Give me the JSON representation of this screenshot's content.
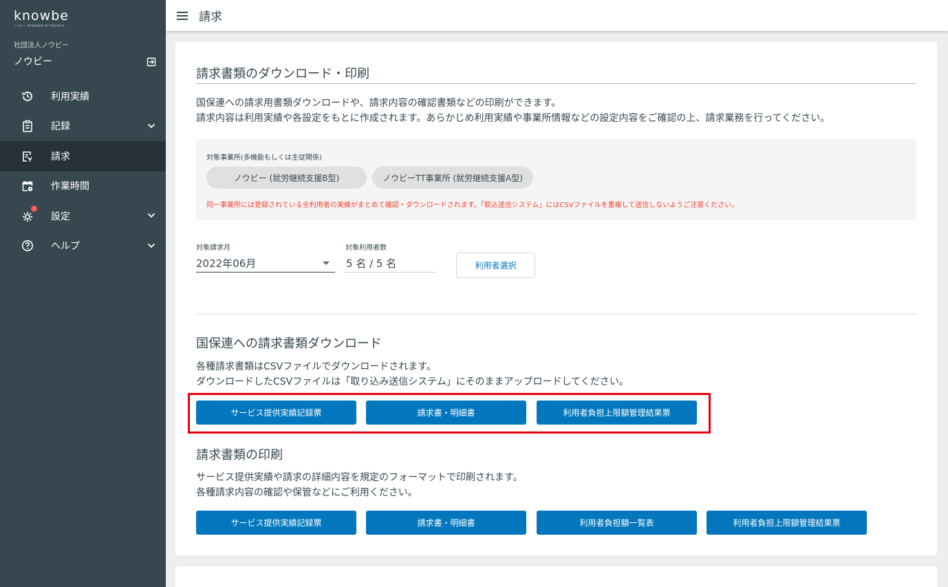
{
  "app": {
    "logo": "knowbe",
    "logo_sub": "ノウビー POWERED BY RECRUIT",
    "org": "社団法人ノウビー",
    "facility": "ノウビー"
  },
  "nav": [
    {
      "label": "利用実績",
      "icon": "history-icon"
    },
    {
      "label": "記録",
      "icon": "clipboard-icon",
      "expandable": true
    },
    {
      "label": "請求",
      "icon": "invoice-icon",
      "active": true
    },
    {
      "label": "作業時間",
      "icon": "calendar-clock-icon"
    },
    {
      "label": "設定",
      "icon": "gear-icon",
      "expandable": true,
      "badge": "!"
    },
    {
      "label": "ヘルプ",
      "icon": "help-circle-icon",
      "expandable": true
    }
  ],
  "header": {
    "title": "請求"
  },
  "download_print": {
    "title": "請求書類のダウンロード・印刷",
    "desc1": "国保連への請求用書類ダウンロードや、請求内容の確認書類などの印刷ができます。",
    "desc2": "請求内容は利用実績や各設定をもとに作成されます。あらかじめ利用実績や事業所情報などの設定内容をご確認の上、請求業務を行ってください。"
  },
  "facilities": {
    "label": "対象事業所(多機能もしくは主従関係)",
    "chips": [
      "ノウビー (就労継続支援B型)",
      "ノウビーTT事業所 (就労継続支援A型)"
    ],
    "note": "同一事業所には登録されている全利用者の実績がまとめて確認・ダウンロードされます。「取込送信システム」にはCSVファイルを重複して送信しないようご注意ください。"
  },
  "filters": {
    "month_label": "対象請求月",
    "month_value": "2022年06月",
    "users_label": "対象利用者数",
    "users_value": "5 名 / 5 名",
    "user_select_button": "利用者選択"
  },
  "csv_download": {
    "title": "国保連への請求書類ダウンロード",
    "desc1": "各種請求書類はCSVファイルでダウンロードされます。",
    "desc2": "ダウンロードしたCSVファイルは「取り込み送信システム」にそのままアップロードしてください。",
    "buttons": [
      "サービス提供実績記録票",
      "請求書・明細書",
      "利用者負担上限額管理結果票"
    ]
  },
  "print": {
    "title": "請求書類の印刷",
    "desc1": "サービス提供実績や請求の詳細内容を規定のフォーマットで印刷されます。",
    "desc2": "各種請求内容の確認や保管などにご利用ください。",
    "buttons": [
      "サービス提供実績記録票",
      "請求書・明細書",
      "利用者負担額一覧表",
      "利用者負担上限額管理結果票"
    ]
  },
  "colors": {
    "sidebar": "#37474f",
    "sidebar_active": "#263238",
    "primary_button": "#0277bd",
    "highlight": "#e60012",
    "warning_text": "#f44336"
  }
}
